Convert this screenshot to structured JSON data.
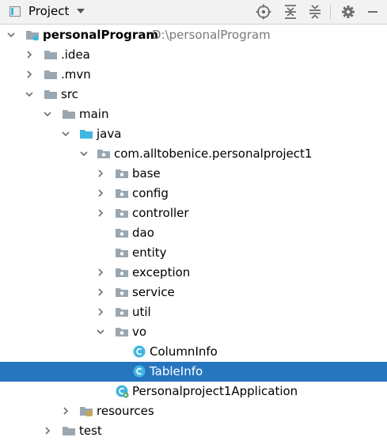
{
  "header": {
    "title": "Project",
    "tools": [
      "locate-icon",
      "expand-all-icon",
      "collapse-all-icon",
      "gear-icon",
      "minimize-icon"
    ]
  },
  "tree": {
    "root": {
      "label": "personalProgram",
      "path": "D:\\personalProgram"
    },
    "idea": {
      "label": ".idea"
    },
    "mvn": {
      "label": ".mvn"
    },
    "src": {
      "label": "src"
    },
    "main": {
      "label": "main"
    },
    "java": {
      "label": "java"
    },
    "package": {
      "label": "com.alltobenice.personalproject1"
    },
    "base": {
      "label": "base"
    },
    "config": {
      "label": "config"
    },
    "controller": {
      "label": "controller"
    },
    "dao": {
      "label": "dao"
    },
    "entity": {
      "label": "entity"
    },
    "exception": {
      "label": "exception"
    },
    "service": {
      "label": "service"
    },
    "util": {
      "label": "util"
    },
    "vo": {
      "label": "vo"
    },
    "columninfo": {
      "label": "ColumnInfo"
    },
    "tableinfo": {
      "label": "TableInfo"
    },
    "application": {
      "label": "Personalproject1Application"
    },
    "resources": {
      "label": "resources"
    },
    "test": {
      "label": "test"
    }
  },
  "colors": {
    "selection": "#2675bf",
    "folder": "#9aa7b0",
    "source_folder": "#40b6e0",
    "class_icon": "#40b6e0"
  }
}
